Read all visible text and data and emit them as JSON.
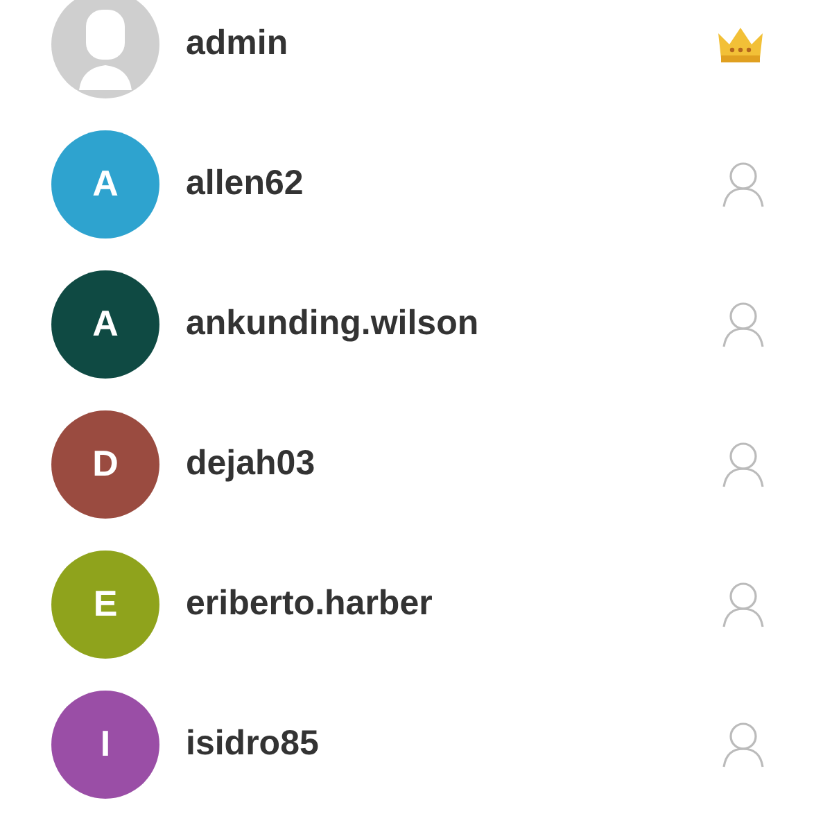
{
  "users": [
    {
      "name": "admin",
      "kind": "admin"
    },
    {
      "name": "allen62",
      "kind": "user",
      "initial": "A",
      "color": "#2ea3cf"
    },
    {
      "name": "ankunding.wilson",
      "kind": "user",
      "initial": "A",
      "color": "#0f4a43"
    },
    {
      "name": "dejah03",
      "kind": "user",
      "initial": "D",
      "color": "#9a4b40"
    },
    {
      "name": "eriberto.harber",
      "kind": "user",
      "initial": "E",
      "color": "#8fa31c"
    },
    {
      "name": "isidro85",
      "kind": "user",
      "initial": "I",
      "color": "#9a4ea6"
    }
  ]
}
